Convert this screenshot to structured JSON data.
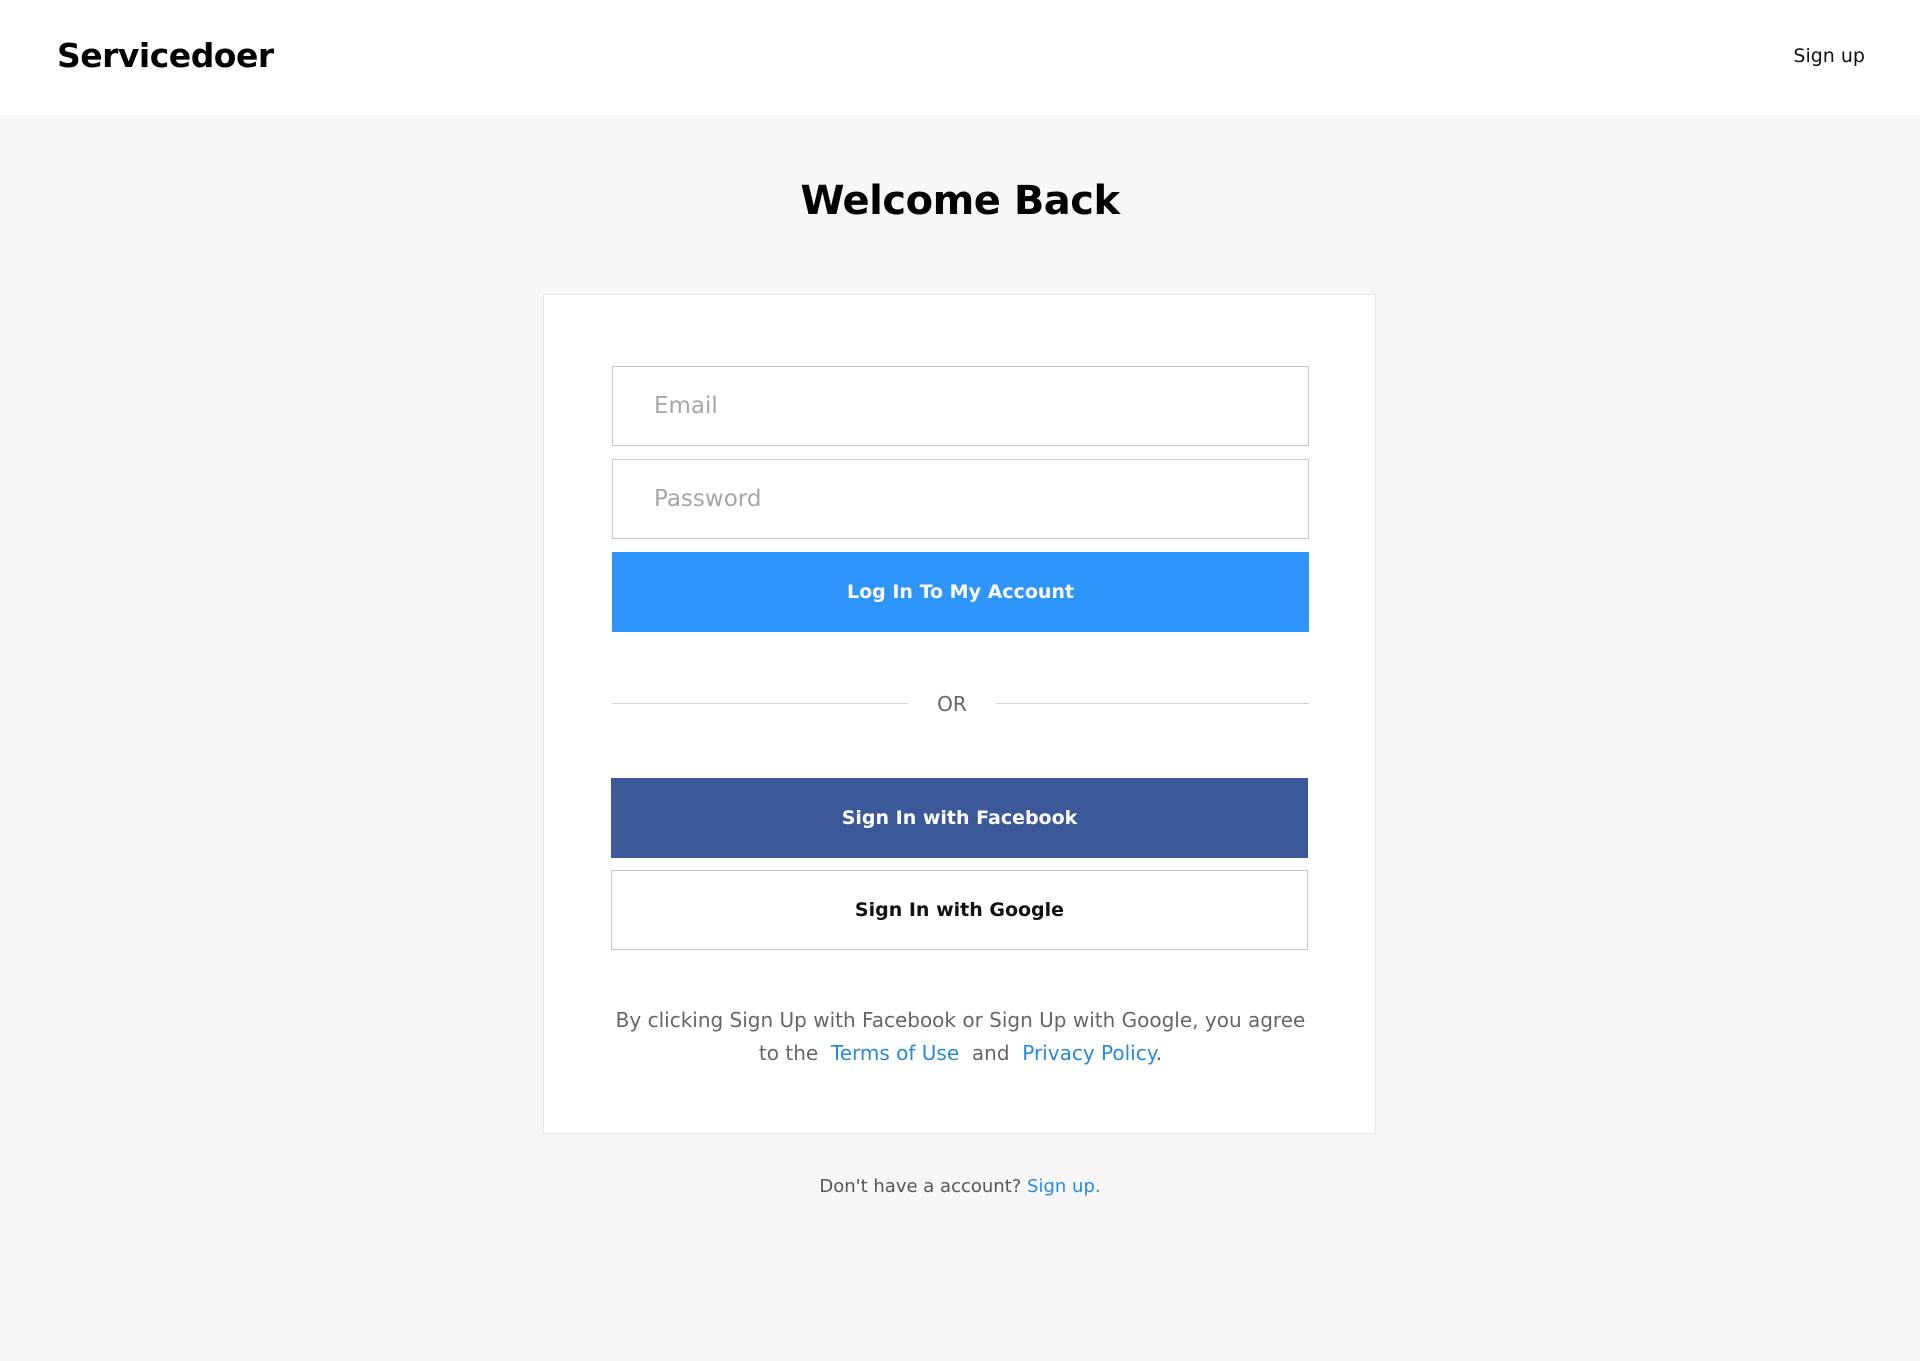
{
  "header": {
    "logo": "Servicedoer",
    "signup_link": "Sign up"
  },
  "main": {
    "title": "Welcome Back"
  },
  "form": {
    "email_placeholder": "Email",
    "password_placeholder": "Password",
    "login_button": "Log In To My Account",
    "divider": "OR",
    "facebook_button": "Sign In with Facebook",
    "google_button": "Sign In with Google",
    "terms": {
      "prefix": "By clicking Sign Up with Facebook or Sign Up with Google, you agree to the",
      "terms_link": "Terms of Use",
      "and": "and",
      "privacy_link": "Privacy Policy",
      "suffix": "."
    }
  },
  "footer": {
    "prompt": "Don't have a account?",
    "signup_link": "Sign up."
  },
  "colors": {
    "accent": "#2e95fd",
    "facebook": "#3b5998",
    "link": "#2789dc",
    "page_background": "#f7f7f7"
  }
}
